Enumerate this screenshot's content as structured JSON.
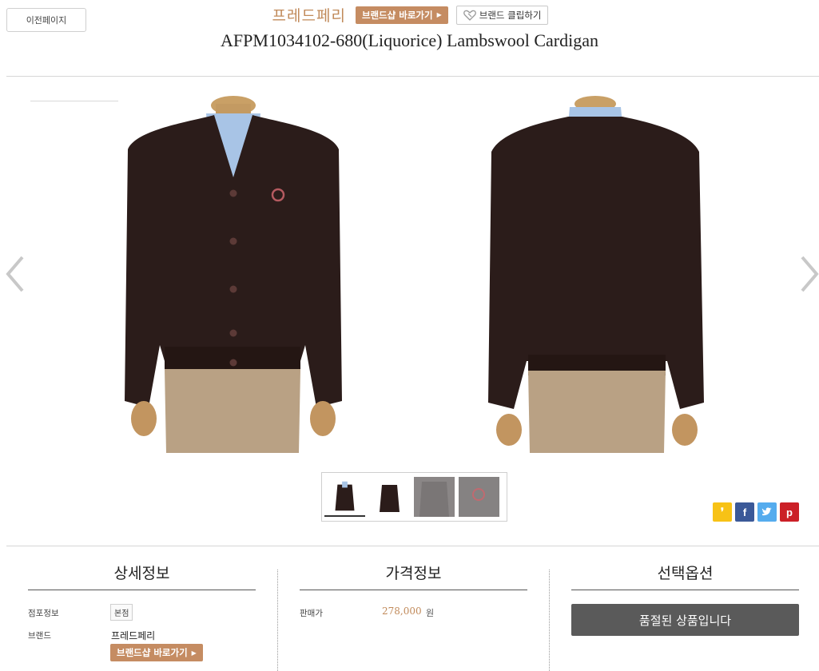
{
  "header": {
    "prev_page": "이전페이지",
    "brand_name": "프레드페리",
    "brand_shop_button": "브랜드샵 바로가기",
    "brand_clip_button": "브랜드 클립하기",
    "product_title": "AFPM1034102-680(Liquorice) Lambswool Cardigan"
  },
  "gallery": {
    "images": [
      {
        "name": "front-view",
        "color": "#2a1d1a"
      },
      {
        "name": "back-view",
        "color": "#2a1d1a"
      }
    ],
    "thumbnails": [
      "front",
      "back",
      "grey-front",
      "grey-detail"
    ]
  },
  "share": {
    "icons": [
      "kakaostory-icon",
      "facebook-icon",
      "twitter-icon",
      "pinterest-icon"
    ],
    "colors": [
      "#f7c216",
      "#3b5998",
      "#55acee",
      "#cb2027"
    ]
  },
  "detail": {
    "title": "상세정보",
    "store_label": "점포정보",
    "store_badge": "본점",
    "brand_label": "브랜드",
    "brand_value": "프레드페리",
    "brand_shop_button": "브랜드샵 바로가기"
  },
  "price": {
    "title": "가격정보",
    "sale_label": "판매가",
    "amount": "278,000",
    "unit": "원"
  },
  "options": {
    "title": "선택옵션",
    "soldout": "품절된 상품입니다"
  }
}
